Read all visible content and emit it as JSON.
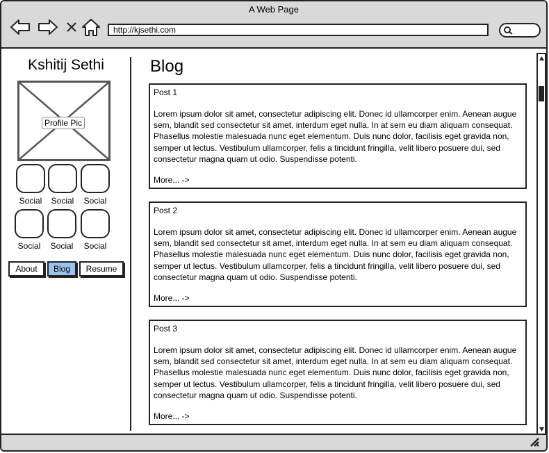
{
  "window": {
    "title": "A Web Page"
  },
  "browser": {
    "url": "http://kjsethi.com",
    "icons": [
      "back-arrow-icon",
      "forward-arrow-icon",
      "close-icon",
      "home-icon",
      "search-icon"
    ]
  },
  "sidebar": {
    "name": "Kshitij Sethi",
    "profile_pic_label": "Profile Pic",
    "social_label": "Social",
    "tabs": [
      {
        "label": "About",
        "active": false
      },
      {
        "label": "Blog",
        "active": true
      },
      {
        "label": "Resume",
        "active": false
      }
    ]
  },
  "main": {
    "heading": "Blog",
    "posts": [
      {
        "title": "Post 1",
        "body": "Lorem ipsum dolor sit amet, consectetur adipiscing elit. Donec id ullamcorper enim. Aenean augue sem, blandit sed consectetur sit amet, interdum eget nulla. In at sem eu diam aliquam consequat. Phasellus molestie malesuada nunc eget elementum. Duis nunc dolor, facilisis eget gravida non, semper ut lectus. Vestibulum ullamcorper, felis a tincidunt fringilla, velit libero posuere dui, sed consectetur magna quam ut odio. Suspendisse potenti.",
        "more": "More... ->"
      },
      {
        "title": "Post 2",
        "body": "Lorem ipsum dolor sit amet, consectetur adipiscing elit. Donec id ullamcorper enim. Aenean augue sem, blandit sed consectetur sit amet, interdum eget nulla. In at sem eu diam aliquam consequat. Phasellus molestie malesuada nunc eget elementum. Duis nunc dolor, facilisis eget gravida non, semper ut lectus. Vestibulum ullamcorper, felis a tincidunt fringilla, velit libero posuere dui, sed consectetur magna quam ut odio. Suspendisse potenti.",
        "more": "More... ->"
      },
      {
        "title": "Post 3",
        "body": "Lorem ipsum dolor sit amet, consectetur adipiscing elit. Donec id ullamcorper enim. Aenean augue sem, blandit sed consectetur sit amet, interdum eget nulla. In at sem eu diam aliquam consequat. Phasellus molestie malesuada nunc eget elementum. Duis nunc dolor, facilisis eget gravida non, semper ut lectus. Vestibulum ullamcorper, felis a tincidunt fringilla, velit libero posuere dui, sed consectetur magna quam ut odio. Suspendisse potenti.",
        "more": "More... ->"
      }
    ]
  },
  "colors": {
    "chrome": "#d9d9d9",
    "active_tab": "#9cc3ec",
    "border": "#222222"
  }
}
